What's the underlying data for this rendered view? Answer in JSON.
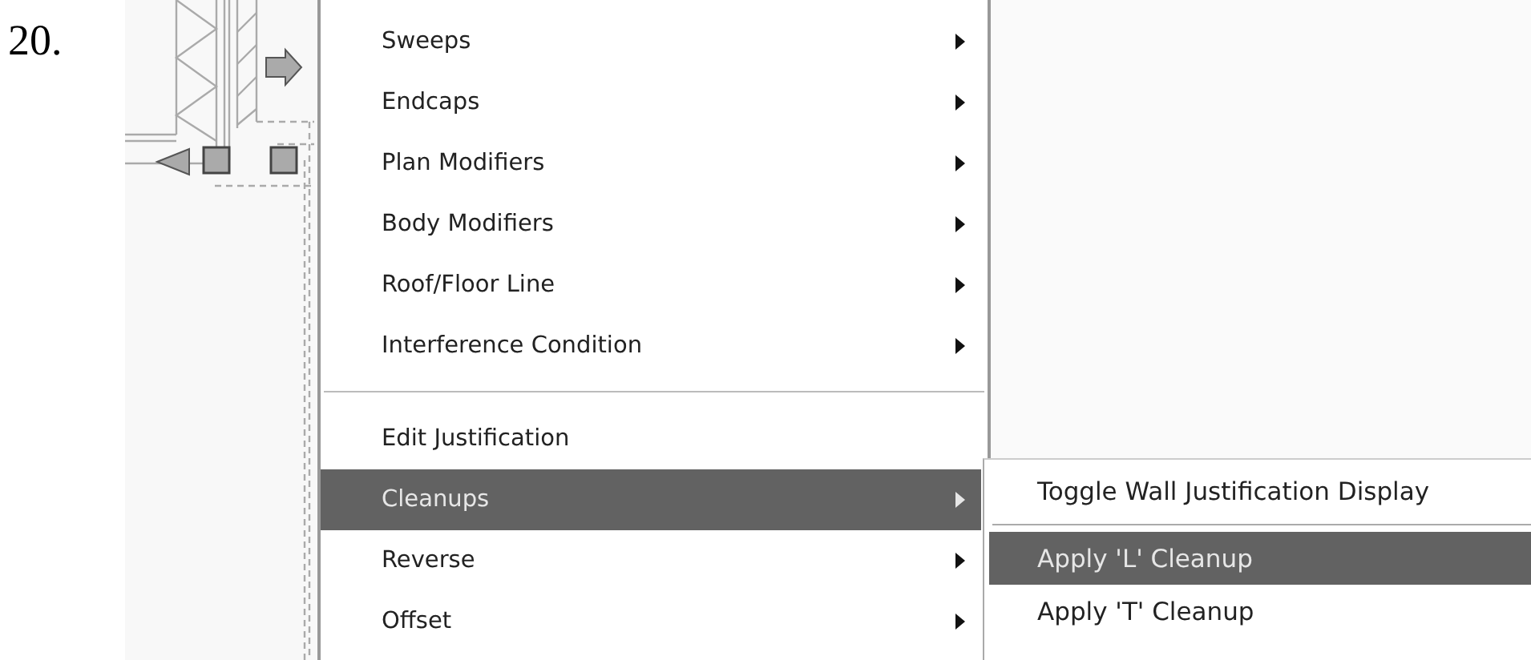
{
  "step_number": "20.",
  "menu": {
    "items": [
      {
        "kind": "item",
        "label": "Sweeps",
        "has_submenu": true,
        "selected": false
      },
      {
        "kind": "item",
        "label": "Endcaps",
        "has_submenu": true,
        "selected": false
      },
      {
        "kind": "item",
        "label": "Plan Modifiers",
        "has_submenu": true,
        "selected": false
      },
      {
        "kind": "item",
        "label": "Body Modifiers",
        "has_submenu": true,
        "selected": false
      },
      {
        "kind": "item",
        "label": "Roof/Floor Line",
        "has_submenu": true,
        "selected": false
      },
      {
        "kind": "item",
        "label": "Interference Condition",
        "has_submenu": true,
        "selected": false
      },
      {
        "kind": "separator"
      },
      {
        "kind": "item",
        "label": "Edit Justification",
        "has_submenu": false,
        "selected": false
      },
      {
        "kind": "item",
        "label": "Cleanups",
        "has_submenu": true,
        "selected": true
      },
      {
        "kind": "item",
        "label": "Reverse",
        "has_submenu": true,
        "selected": false
      },
      {
        "kind": "item",
        "label": "Offset",
        "has_submenu": true,
        "selected": false
      }
    ]
  },
  "submenu": {
    "items": [
      {
        "kind": "item",
        "label": "Toggle Wall Justification Display",
        "selected": false
      },
      {
        "kind": "separator"
      },
      {
        "kind": "item",
        "label": "Apply 'L' Cleanup",
        "selected": true
      },
      {
        "kind": "item",
        "label": "Apply 'T' Cleanup",
        "selected": false
      }
    ]
  }
}
